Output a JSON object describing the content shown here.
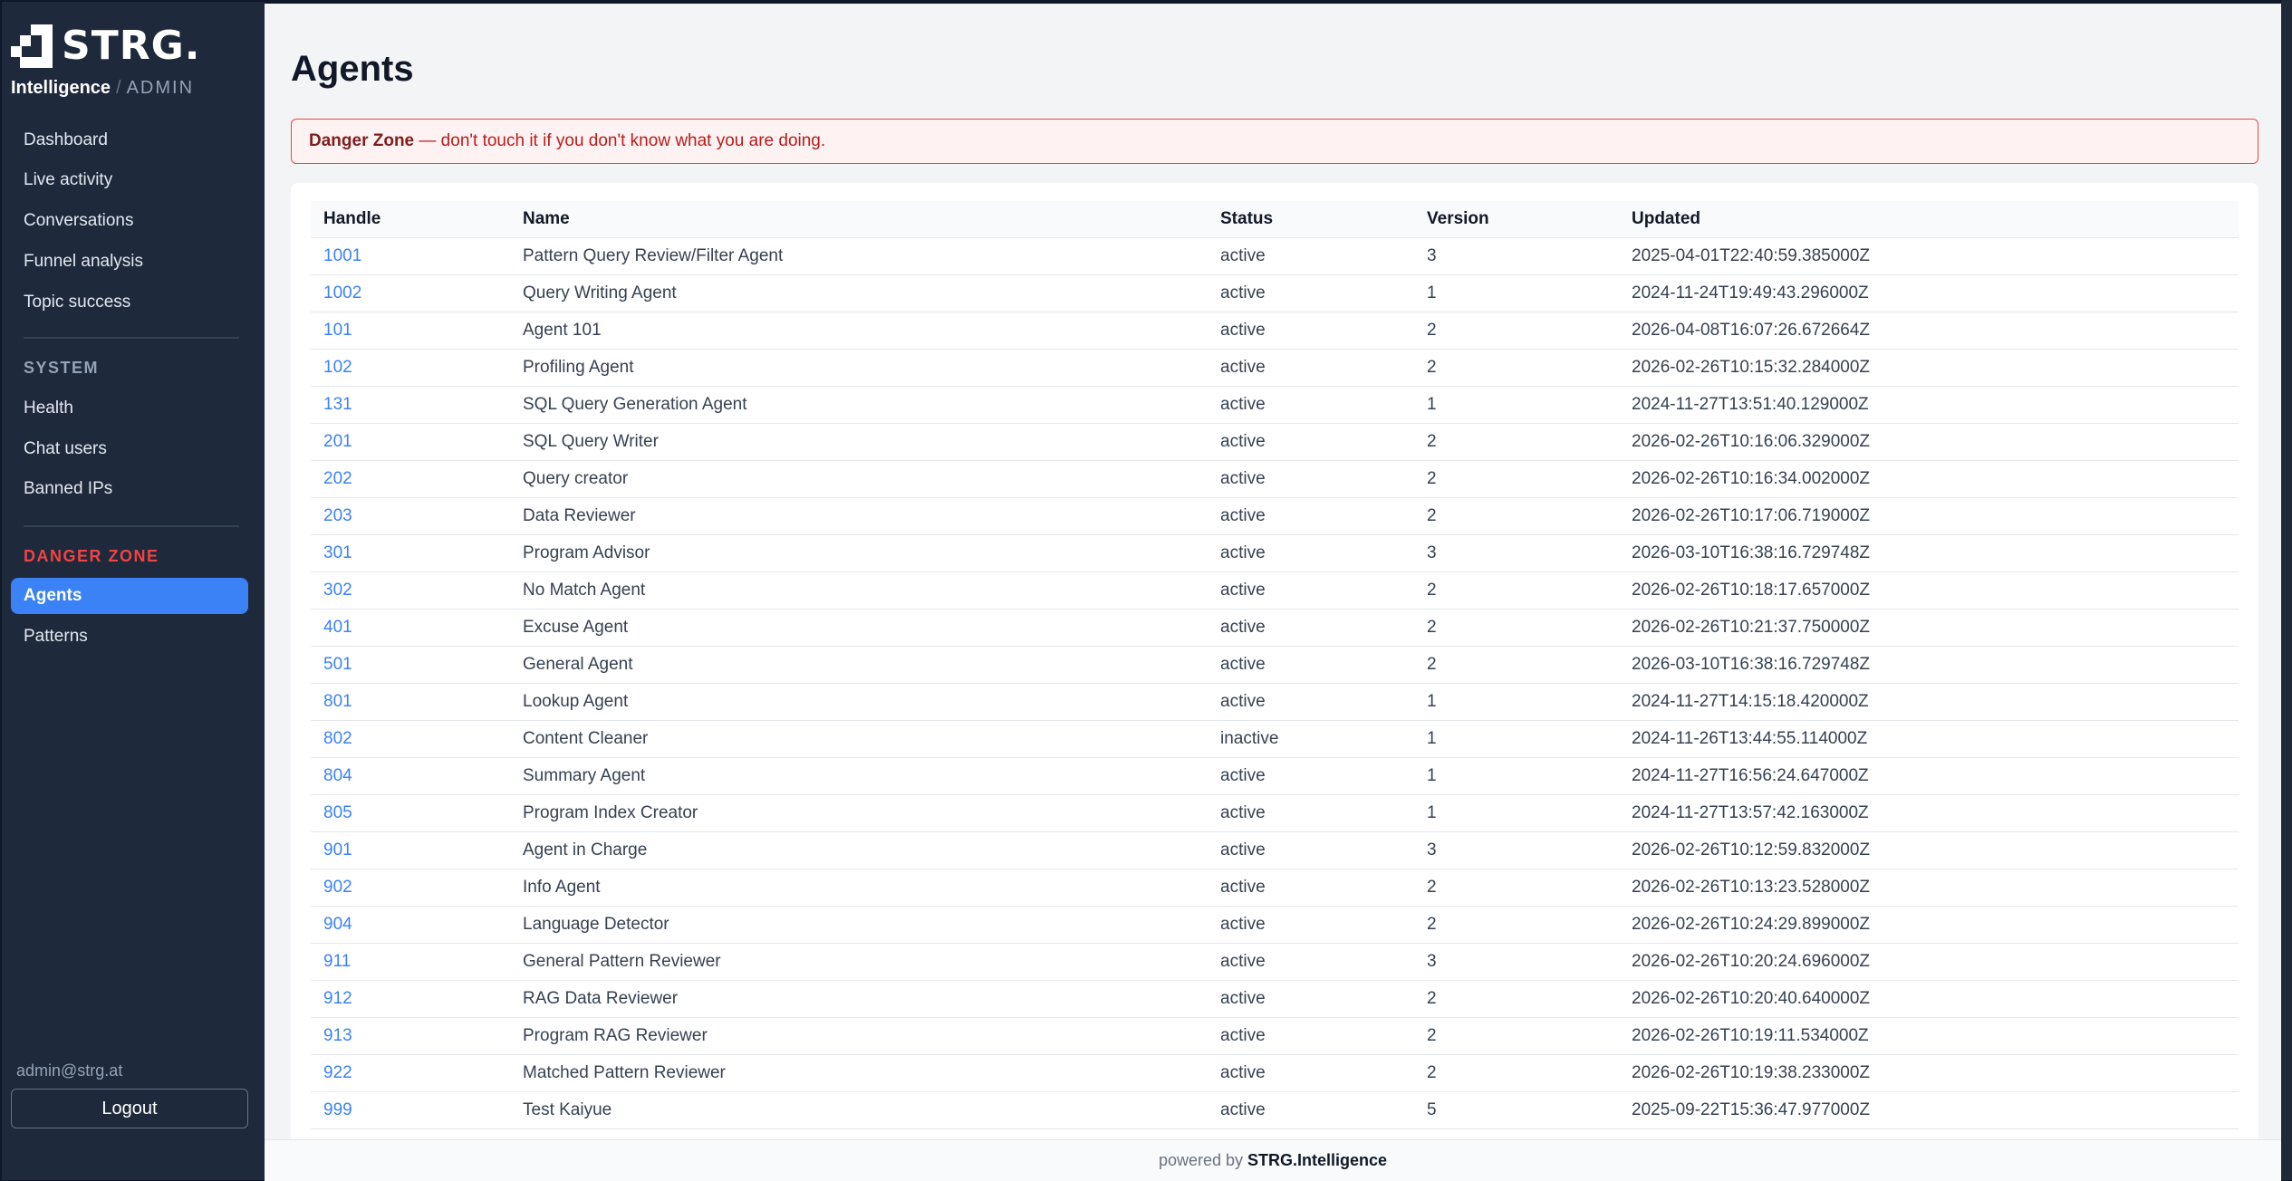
{
  "brand": {
    "logo_text": "STRG.",
    "name": "Intelligence",
    "separator": "/",
    "role": "ADMIN"
  },
  "nav": {
    "main_items": [
      {
        "label": "Dashboard"
      },
      {
        "label": "Live activity"
      },
      {
        "label": "Conversations"
      },
      {
        "label": "Funnel analysis"
      },
      {
        "label": "Topic success"
      }
    ],
    "system_heading": "SYSTEM",
    "system_items": [
      {
        "label": "Health"
      },
      {
        "label": "Chat users"
      },
      {
        "label": "Banned IPs"
      }
    ],
    "danger_heading": "DANGER ZONE",
    "danger_items": [
      {
        "label": "Agents",
        "active": true
      },
      {
        "label": "Patterns",
        "active": false
      }
    ],
    "user_email": "admin@strg.at",
    "logout_label": "Logout"
  },
  "page": {
    "title": "Agents",
    "alert_strong": "Danger Zone",
    "alert_text": " — don't touch it if you don't know what you are doing."
  },
  "table": {
    "columns": [
      "Handle",
      "Name",
      "Status",
      "Version",
      "Updated"
    ],
    "rows": [
      {
        "handle": "1001",
        "name": "Pattern Query Review/Filter Agent",
        "status": "active",
        "version": "3",
        "updated": "2025-04-01T22:40:59.385000Z"
      },
      {
        "handle": "1002",
        "name": "Query Writing Agent",
        "status": "active",
        "version": "1",
        "updated": "2024-11-24T19:49:43.296000Z"
      },
      {
        "handle": "101",
        "name": "Agent 101",
        "status": "active",
        "version": "2",
        "updated": "2026-04-08T16:07:26.672664Z"
      },
      {
        "handle": "102",
        "name": "Profiling Agent",
        "status": "active",
        "version": "2",
        "updated": "2026-02-26T10:15:32.284000Z"
      },
      {
        "handle": "131",
        "name": "SQL Query Generation Agent",
        "status": "active",
        "version": "1",
        "updated": "2024-11-27T13:51:40.129000Z"
      },
      {
        "handle": "201",
        "name": "SQL Query Writer",
        "status": "active",
        "version": "2",
        "updated": "2026-02-26T10:16:06.329000Z"
      },
      {
        "handle": "202",
        "name": "Query creator",
        "status": "active",
        "version": "2",
        "updated": "2026-02-26T10:16:34.002000Z"
      },
      {
        "handle": "203",
        "name": "Data Reviewer",
        "status": "active",
        "version": "2",
        "updated": "2026-02-26T10:17:06.719000Z"
      },
      {
        "handle": "301",
        "name": "Program Advisor",
        "status": "active",
        "version": "3",
        "updated": "2026-03-10T16:38:16.729748Z"
      },
      {
        "handle": "302",
        "name": "No Match Agent",
        "status": "active",
        "version": "2",
        "updated": "2026-02-26T10:18:17.657000Z"
      },
      {
        "handle": "401",
        "name": "Excuse Agent",
        "status": "active",
        "version": "2",
        "updated": "2026-02-26T10:21:37.750000Z"
      },
      {
        "handle": "501",
        "name": "General Agent",
        "status": "active",
        "version": "2",
        "updated": "2026-03-10T16:38:16.729748Z"
      },
      {
        "handle": "801",
        "name": "Lookup Agent",
        "status": "active",
        "version": "1",
        "updated": "2024-11-27T14:15:18.420000Z"
      },
      {
        "handle": "802",
        "name": "Content Cleaner",
        "status": "inactive",
        "version": "1",
        "updated": "2024-11-26T13:44:55.114000Z"
      },
      {
        "handle": "804",
        "name": "Summary Agent",
        "status": "active",
        "version": "1",
        "updated": "2024-11-27T16:56:24.647000Z"
      },
      {
        "handle": "805",
        "name": "Program Index Creator",
        "status": "active",
        "version": "1",
        "updated": "2024-11-27T13:57:42.163000Z"
      },
      {
        "handle": "901",
        "name": "Agent in Charge",
        "status": "active",
        "version": "3",
        "updated": "2026-02-26T10:12:59.832000Z"
      },
      {
        "handle": "902",
        "name": "Info Agent",
        "status": "active",
        "version": "2",
        "updated": "2026-02-26T10:13:23.528000Z"
      },
      {
        "handle": "904",
        "name": "Language Detector",
        "status": "active",
        "version": "2",
        "updated": "2026-02-26T10:24:29.899000Z"
      },
      {
        "handle": "911",
        "name": "General Pattern Reviewer",
        "status": "active",
        "version": "3",
        "updated": "2026-02-26T10:20:24.696000Z"
      },
      {
        "handle": "912",
        "name": "RAG Data Reviewer",
        "status": "active",
        "version": "2",
        "updated": "2026-02-26T10:20:40.640000Z"
      },
      {
        "handle": "913",
        "name": "Program RAG Reviewer",
        "status": "active",
        "version": "2",
        "updated": "2026-02-26T10:19:11.534000Z"
      },
      {
        "handle": "922",
        "name": "Matched Pattern Reviewer",
        "status": "active",
        "version": "2",
        "updated": "2026-02-26T10:19:38.233000Z"
      },
      {
        "handle": "999",
        "name": "Test Kaiyue",
        "status": "active",
        "version": "5",
        "updated": "2025-09-22T15:36:47.977000Z"
      }
    ]
  },
  "footer": {
    "prefix": "powered by",
    "brand": "STRG.Intelligence"
  },
  "colors": {
    "sidebar_bg": "#1e293b",
    "accent": "#3b82f6",
    "danger": "#ef4444",
    "link": "#3b82f6"
  }
}
